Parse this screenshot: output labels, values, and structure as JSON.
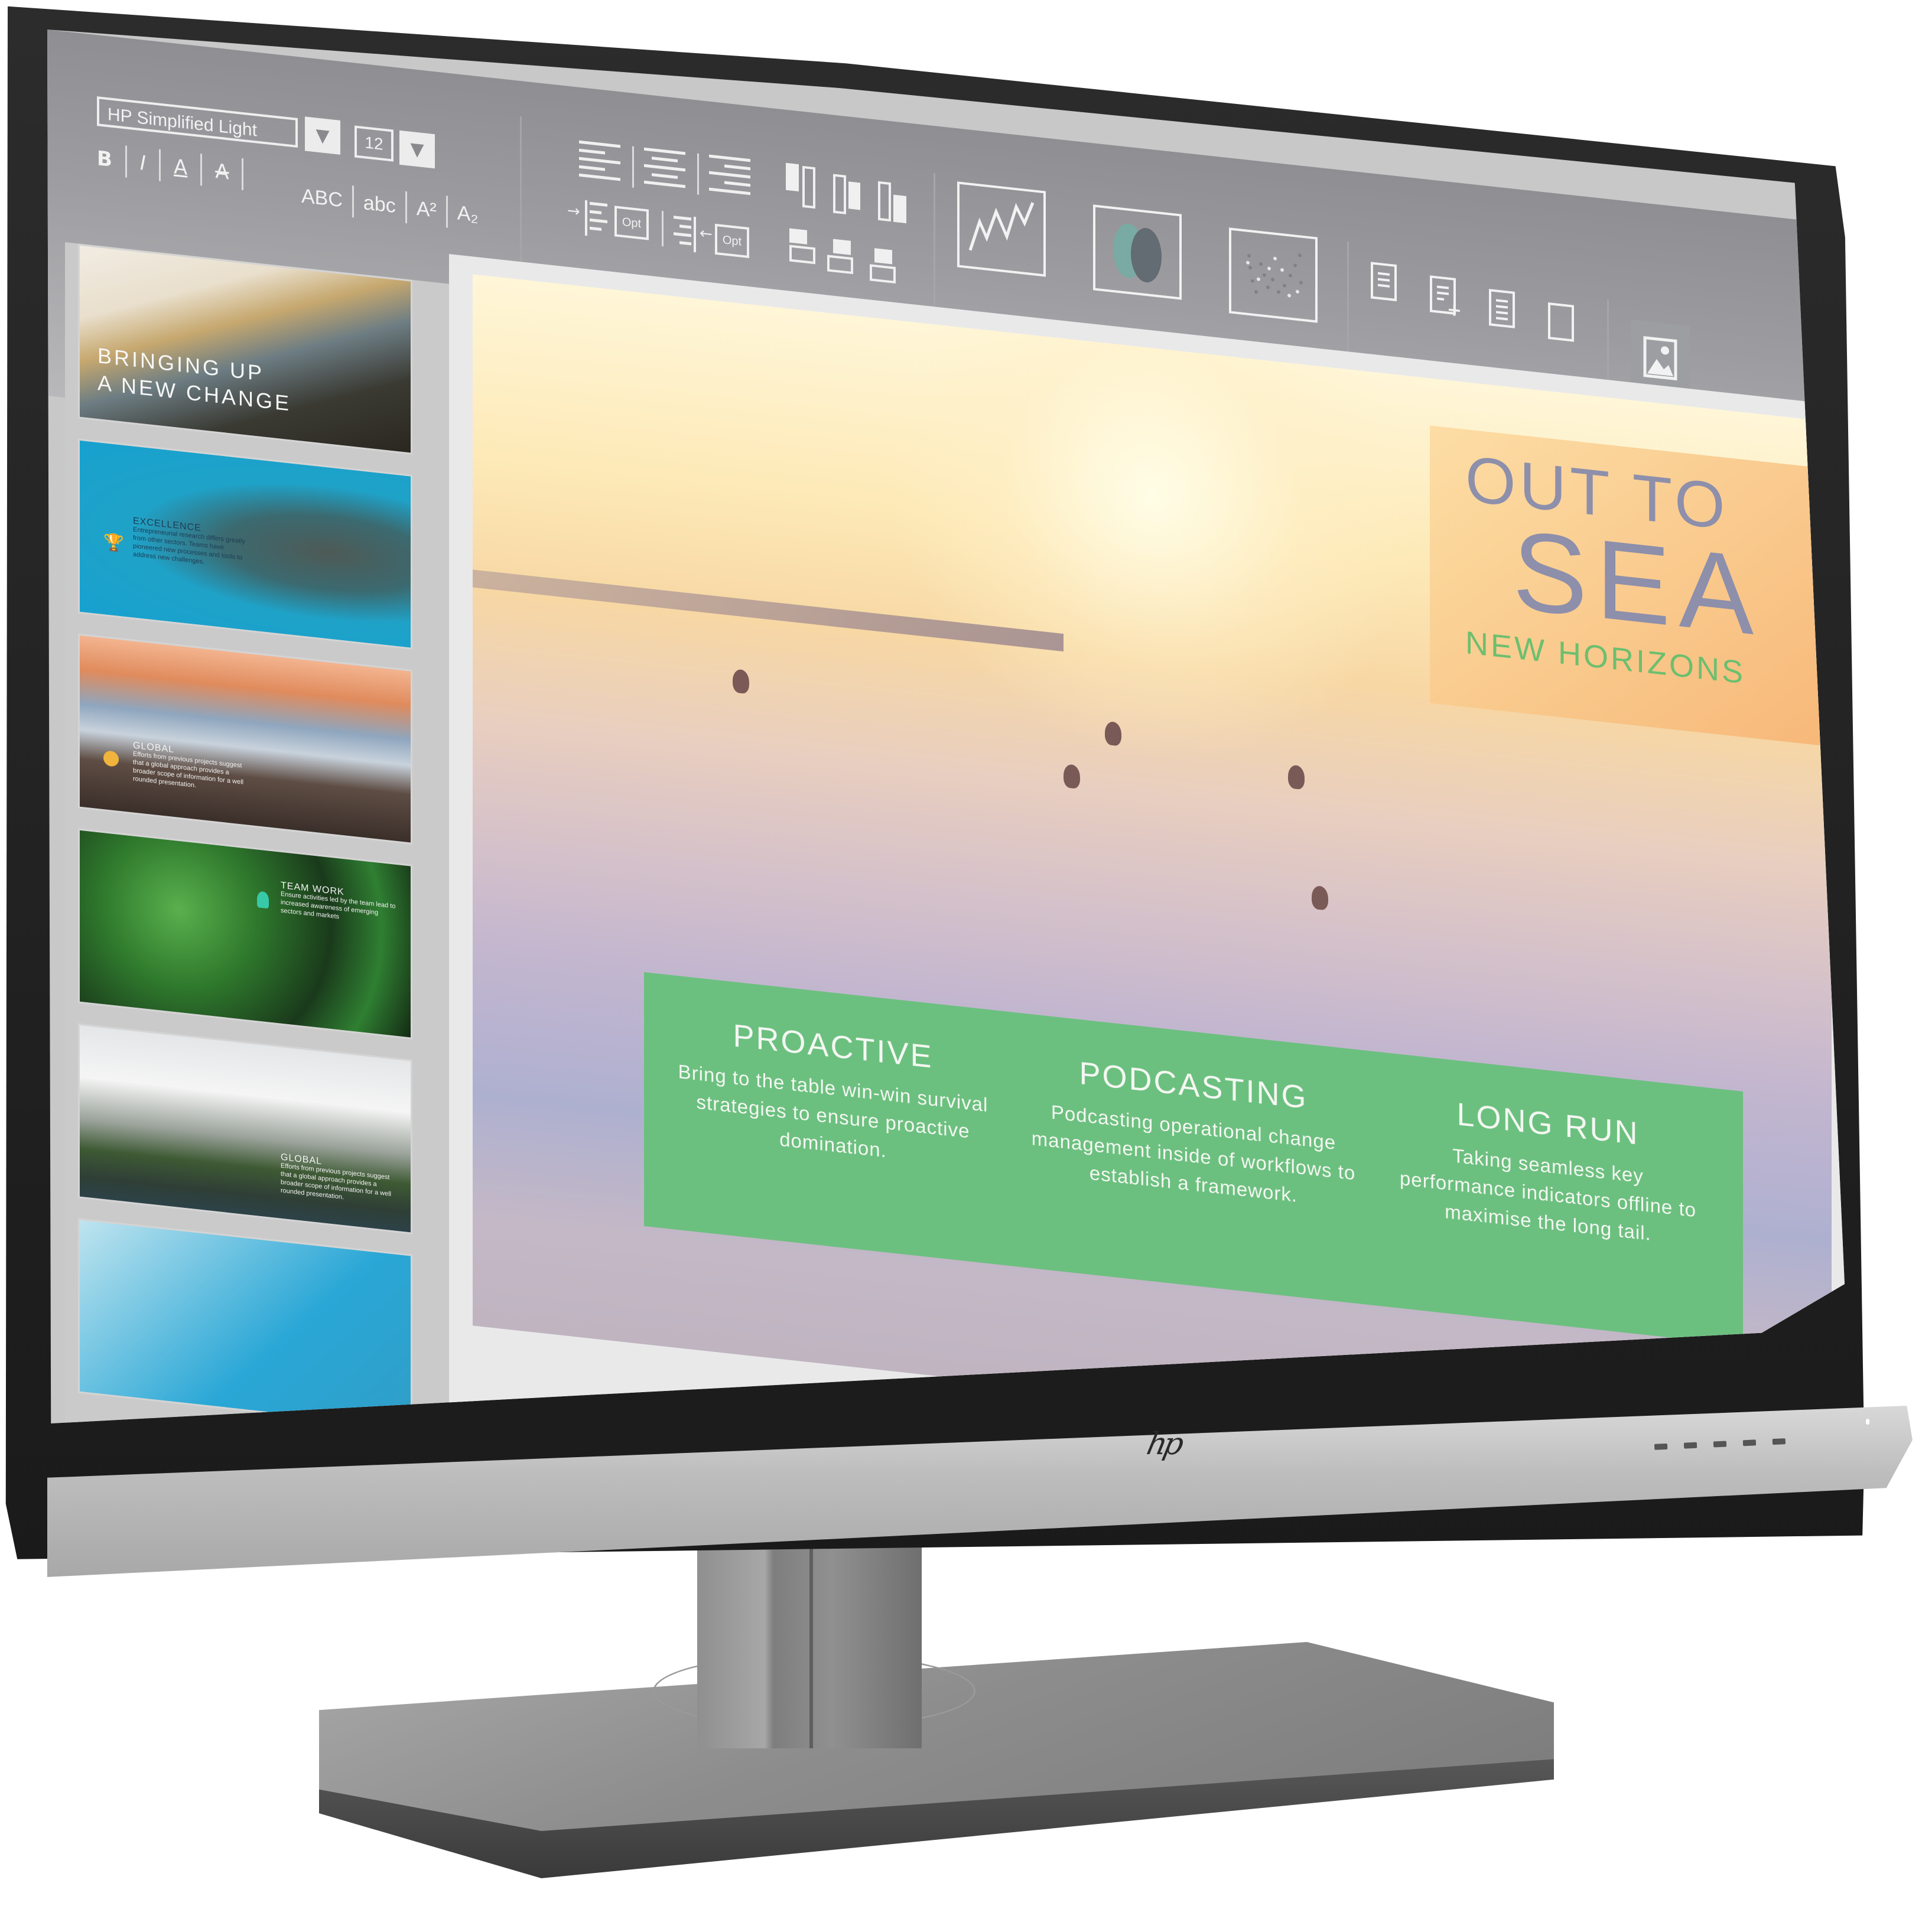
{
  "device": {
    "brand_logo": "hp",
    "colors": {
      "bezel": "#1f1f1f",
      "chassis": "#bdbdbd",
      "stand": "#8d8d8d"
    }
  },
  "toolbar": {
    "font_family_value": "HP Simplified Light",
    "font_size_value": "12",
    "dropdown_glyph": "▼",
    "format_buttons": [
      {
        "id": "bold",
        "label": "B"
      },
      {
        "id": "italic",
        "label": "I"
      },
      {
        "id": "underline",
        "label": "A"
      },
      {
        "id": "strikethrough",
        "label": "A"
      }
    ],
    "case_buttons": [
      {
        "id": "uppercase",
        "label": "ABC"
      },
      {
        "id": "lowercase",
        "label": "abc"
      },
      {
        "id": "superscript",
        "label": "A²"
      },
      {
        "id": "subscript",
        "label": "A₂"
      }
    ],
    "paragraph": {
      "align_buttons": [
        "align-left-icon",
        "align-center-icon",
        "align-right-icon"
      ],
      "indent_option_label": "Opt",
      "outdent_option_label": "Opt",
      "indent_arrow": "→",
      "outdent_arrow": "←"
    },
    "chart_buttons": [
      "line-chart-icon",
      "venn-chart-icon",
      "scatter-chart-icon"
    ],
    "document_buttons": [
      "notepad-icon",
      "notepad-add-icon",
      "document-icon",
      "blank-document-icon"
    ],
    "insert_image_button": "image-icon",
    "colors": {
      "toolbar_bg": "#9a9a9e",
      "icon": "#f2f2f2",
      "venn_left": "#79aaa3",
      "venn_right": "#636b73"
    }
  },
  "thumbnails": [
    {
      "title_line1": "BRINGING UP",
      "title_line2": "A NEW CHANGE",
      "heading": "",
      "body": "",
      "icon": ""
    },
    {
      "title_line1": "",
      "title_line2": "",
      "heading": "EXCELLENCE",
      "body": "Entrepreneurial research differs greatly from other sectors. Teams have pioneered new processes and tools to address new challenges.",
      "icon": "trophy-icon"
    },
    {
      "title_line1": "",
      "title_line2": "",
      "heading": "GLOBAL",
      "body": "Efforts from previous projects suggest that a global approach provides a broader scope of information for a well rounded presentation.",
      "icon": "globe-icon"
    },
    {
      "title_line1": "",
      "title_line2": "",
      "heading": "TEAM WORK",
      "body": "Ensure activities led by the team lead to increased awareness of emerging sectors and markets",
      "icon": "person-icon"
    },
    {
      "title_line1": "",
      "title_line2": "",
      "heading": "GLOBAL",
      "body": "Efforts from previous projects suggest that a global approach provides a broader scope of information for a well rounded presentation.",
      "icon": ""
    },
    {
      "title_line1": "",
      "title_line2": "",
      "heading": "",
      "body": "",
      "icon": ""
    }
  ],
  "slide": {
    "title_line1": "OUT TO",
    "title_line2": "SEA",
    "subtitle": "NEW HORIZONS",
    "colors": {
      "title": "#8d8fab",
      "subtitle": "#6cbf6f",
      "panel": "#6cc07f"
    },
    "columns": [
      {
        "heading": "PROACTIVE",
        "body": "Bring to the table win-win survival strategies to ensure proactive domination."
      },
      {
        "heading": "PODCASTING",
        "body": "Podcasting operational change management inside of workflows to establish a framework."
      },
      {
        "heading": "LONG RUN",
        "body": "Taking seamless key performance indicators offline to maximise the long tail."
      }
    ]
  }
}
